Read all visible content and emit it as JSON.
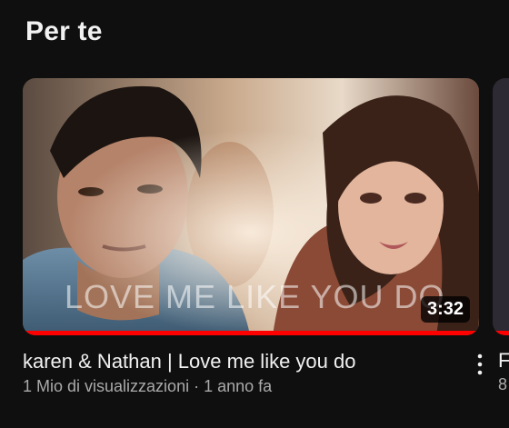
{
  "section": {
    "title": "Per te"
  },
  "video": {
    "overlay_text": "LOVE ME LIKE YOU DO",
    "duration": "3:32",
    "progress_fraction": 1.0,
    "title": "karen & Nathan | Love me like you do",
    "views": "1 Mio di visualizzazioni",
    "separator": "·",
    "age": "1 anno fa",
    "more_icon": "more-vert-icon"
  },
  "next_video": {
    "title_fragment": "F",
    "sub_fragment": "8"
  },
  "colors": {
    "background": "#0f0f0f",
    "progress": "#ff0000",
    "primary_text": "#f1f1f1",
    "secondary_text": "#aaaaaa"
  }
}
